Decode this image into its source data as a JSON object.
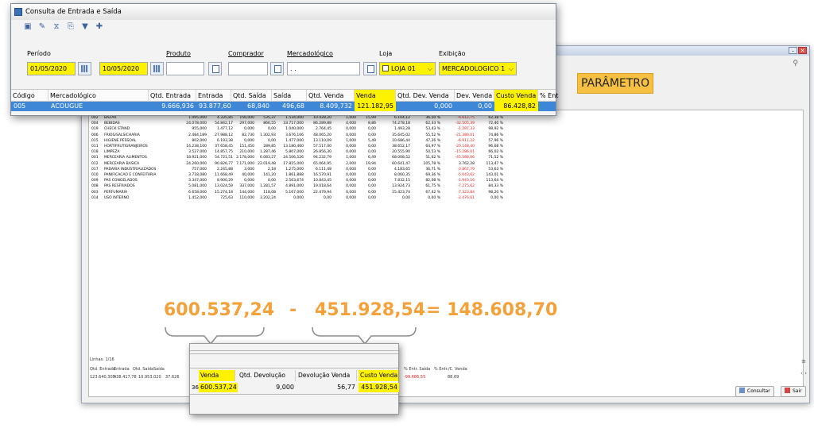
{
  "window_title": "Consulta de Entrada e Saída",
  "toolbar_icons": [
    "search-report-icon",
    "edit-icon",
    "filter-clear-icon",
    "export-icon",
    "filter-icon",
    "pin-icon"
  ],
  "filters": {
    "periodo_label": "Período",
    "date_from": "01/05/2020",
    "date_sep": "a",
    "date_to": "10/05/2020",
    "produto_label": "Produto",
    "comprador_label": "Comprador",
    "mercadologico_label": "Mercadológico",
    "mercadologico_value": ". .",
    "loja_label": "Loja",
    "loja_value": "LOJA 01",
    "exibicao_label": "Exibição",
    "exibicao_value": "MERCADOLOGICO 1"
  },
  "grid": {
    "headers": [
      "Código",
      "Mercadológico",
      "Qtd. Entrada",
      "Entrada",
      "Qtd. Saída",
      "Saída",
      "Qtd. Venda",
      "Venda",
      "Qtd. Dev. Venda",
      "Dev. Venda",
      "Custo Venda",
      "% Ent"
    ],
    "selected_row": [
      "005",
      "ACOUGUE",
      "9.666,936",
      "93.877,60",
      "68,840",
      "496,68",
      "8.409,732",
      "121.182,95",
      "0,000",
      "0,00",
      "86.428,82",
      ""
    ]
  },
  "parametro_label": "PARÂMETRO",
  "background_rows": [
    [
      "002",
      "BAZAR",
      "1.095,000",
      "4.335,85",
      "156,000",
      "535,37",
      "1.534,000",
      "10.428,20",
      "1,000",
      "15,99",
      "6.104,12",
      "36,50 %",
      "-6.612,75",
      "62,38 %"
    ],
    [
      "004",
      "BEBIDAS",
      "24.078,000",
      "54.842,17",
      "297,000",
      "866,55",
      "33.717,000",
      "86.289,88",
      "4,000",
      "8,86",
      "74.278,18",
      "62,33 %",
      "-32.505,39",
      "72,40 %"
    ],
    [
      "019",
      "CHECK STAND",
      "955,000",
      "1.477,12",
      "0,000",
      "0,00",
      "1.040,000",
      "2.764,45",
      "0,000",
      "0,00",
      "1.493,28",
      "53,43 %",
      "-1.287,33",
      "98,92 %"
    ],
    [
      "006",
      "FRIOS/SALSICHARIA",
      "2.484,189",
      "27.988,12",
      "82,730",
      "1.302,93",
      "3.676,106",
      "48.065,20",
      "0,000",
      "0,00",
      "35.645,02",
      "55,52 %",
      "-21.380,01",
      "74,86 %"
    ],
    [
      "015",
      "HIGIENE PESSOAL",
      "802,000",
      "6.193,38",
      "0,000",
      "0,00",
      "1.477,000",
      "13.110,09",
      "1,000",
      "5,49",
      "10.686,44",
      "47,26 %",
      "-6.911,22",
      "57,96 %"
    ],
    [
      "011",
      "HORTIFRUTIGRANJEIROS",
      "14.238,100",
      "37.658,45",
      "151,450",
      "289,85",
      "13.180,460",
      "57.517,00",
      "0,000",
      "0,00",
      "38.652,17",
      "64,97 %",
      "-20.148,40",
      "96,68 %"
    ],
    [
      "018",
      "LIMPEZA",
      "3.527,000",
      "14.857,75",
      "210,000",
      "1.287,46",
      "5.807,000",
      "26.856,30",
      "0,000",
      "0,00",
      "20.555,90",
      "50,53 %",
      "-15.286,01",
      "66,02 %"
    ],
    [
      "001",
      "MERCEARIA ALIMENTOS",
      "18.921,000",
      "54.721,51",
      "2.178,000",
      "6.083,27",
      "24.506,526",
      "94.232,79",
      "1,000",
      "6,49",
      "68.008,52",
      "51,62 %",
      "-45.588,06",
      "71,52 %"
    ],
    [
      "012",
      "MERCEARIA BASICA",
      "24.260,000",
      "90.826,77",
      "7.171,000",
      "22.019,48",
      "17.815,000",
      "65.064,95",
      "2,000",
      "19,94",
      "60.641,47",
      "105,78 %",
      "3.762,28",
      "113,47 %"
    ],
    [
      "017",
      "PADARIA INDUSTRIALIZADOS",
      "757,000",
      "2.245,88",
      "3,000",
      "2,18",
      "1.275,000",
      "6.111,48",
      "0,000",
      "0,00",
      "4.183,65",
      "36,71 %",
      "-3.867,79",
      "53,63 %"
    ],
    [
      "010",
      "PANIFICACAO E CONFEITARIA",
      "3.718,080",
      "11.668,49",
      "40,000",
      "141,20",
      "1.861,888",
      "16.570,91",
      "0,000",
      "0,00",
      "8.060,35",
      "69,36 %",
      "-5.043,62",
      "143,01 %"
    ],
    [
      "009",
      "PAS CONGELADOS",
      "3.347,000",
      "8.900,29",
      "0,000",
      "0,00",
      "2.563,674",
      "10.843,45",
      "0,000",
      "0,00",
      "7.832,15",
      "82,08 %",
      "-1.943,16",
      "113,64 %"
    ],
    [
      "008",
      "PAS RESFRIADOS",
      "5.081,000",
      "13.024,59",
      "337,000",
      "1.281,57",
      "4.891,000",
      "19.018,64",
      "0,000",
      "0,00",
      "13.924,73",
      "61,75 %",
      "-7.275,62",
      "84,33 %"
    ],
    [
      "003",
      "PERFUMARIA",
      "6.658,000",
      "15.274,18",
      "144,000",
      "118,08",
      "5.167,000",
      "22.479,94",
      "0,000",
      "0,00",
      "15.423,74",
      "67,42 %",
      "-7.323,84",
      "98,20 %"
    ],
    [
      "014",
      "USO INTERNO",
      "1.452,000",
      "725,63",
      "110,000",
      "3.202,24",
      "0,000",
      "0,00",
      "0,000",
      "0,00",
      "0,00",
      "0,00 %",
      "-2.476,61",
      "0,00 %"
    ]
  ],
  "linhas": "Linhas: 1/16",
  "totals": {
    "headers": [
      "Qtd. Entrada",
      "Entrada",
      "Qtd. Saída",
      "Saída",
      "% Entr. Saída",
      "% Entr./C. Venda"
    ],
    "values": [
      "123.640,305",
      "438.417,78",
      "10.953,020",
      "37.626",
      "-99.686,55",
      "88,69"
    ]
  },
  "buttons": {
    "consultar": "Consultar",
    "sair": "Sair"
  },
  "zoom": {
    "headers": [
      "Venda",
      "Qtd. Devolução",
      "Devolução Venda",
      "Custo Venda"
    ],
    "values": [
      "600.537,24",
      "9,000",
      "56,77",
      "451.928,54"
    ],
    "left_fragment": "36"
  },
  "calc": {
    "a": "600.537,24",
    "op": "-",
    "b": "451.928,54",
    "result": "= 148.608,70"
  },
  "colors": {
    "highlight": "#fff200",
    "selection": "#3d87d6",
    "annotation": "#f5a13a",
    "negative": "#e02020"
  }
}
